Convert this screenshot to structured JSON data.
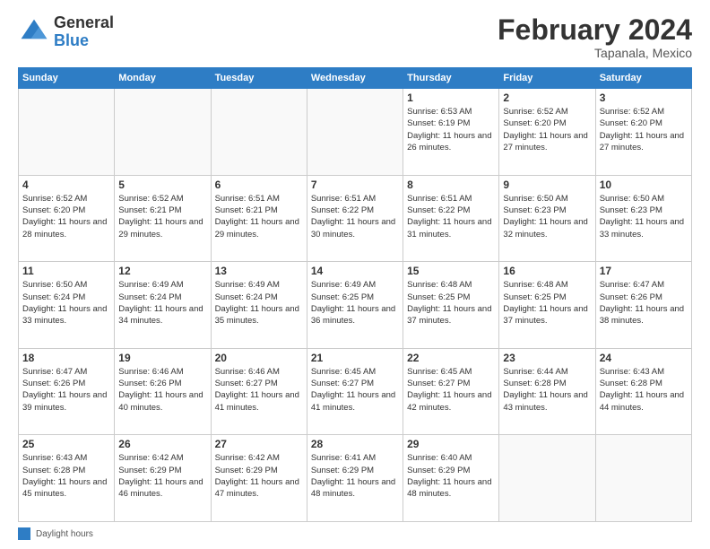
{
  "logo": {
    "general": "General",
    "blue": "Blue"
  },
  "title": "February 2024",
  "subtitle": "Tapanala, Mexico",
  "days_of_week": [
    "Sunday",
    "Monday",
    "Tuesday",
    "Wednesday",
    "Thursday",
    "Friday",
    "Saturday"
  ],
  "weeks": [
    [
      {
        "day": "",
        "info": ""
      },
      {
        "day": "",
        "info": ""
      },
      {
        "day": "",
        "info": ""
      },
      {
        "day": "",
        "info": ""
      },
      {
        "day": "1",
        "info": "Sunrise: 6:53 AM\nSunset: 6:19 PM\nDaylight: 11 hours and 26 minutes."
      },
      {
        "day": "2",
        "info": "Sunrise: 6:52 AM\nSunset: 6:20 PM\nDaylight: 11 hours and 27 minutes."
      },
      {
        "day": "3",
        "info": "Sunrise: 6:52 AM\nSunset: 6:20 PM\nDaylight: 11 hours and 27 minutes."
      }
    ],
    [
      {
        "day": "4",
        "info": "Sunrise: 6:52 AM\nSunset: 6:20 PM\nDaylight: 11 hours and 28 minutes."
      },
      {
        "day": "5",
        "info": "Sunrise: 6:52 AM\nSunset: 6:21 PM\nDaylight: 11 hours and 29 minutes."
      },
      {
        "day": "6",
        "info": "Sunrise: 6:51 AM\nSunset: 6:21 PM\nDaylight: 11 hours and 29 minutes."
      },
      {
        "day": "7",
        "info": "Sunrise: 6:51 AM\nSunset: 6:22 PM\nDaylight: 11 hours and 30 minutes."
      },
      {
        "day": "8",
        "info": "Sunrise: 6:51 AM\nSunset: 6:22 PM\nDaylight: 11 hours and 31 minutes."
      },
      {
        "day": "9",
        "info": "Sunrise: 6:50 AM\nSunset: 6:23 PM\nDaylight: 11 hours and 32 minutes."
      },
      {
        "day": "10",
        "info": "Sunrise: 6:50 AM\nSunset: 6:23 PM\nDaylight: 11 hours and 33 minutes."
      }
    ],
    [
      {
        "day": "11",
        "info": "Sunrise: 6:50 AM\nSunset: 6:24 PM\nDaylight: 11 hours and 33 minutes."
      },
      {
        "day": "12",
        "info": "Sunrise: 6:49 AM\nSunset: 6:24 PM\nDaylight: 11 hours and 34 minutes."
      },
      {
        "day": "13",
        "info": "Sunrise: 6:49 AM\nSunset: 6:24 PM\nDaylight: 11 hours and 35 minutes."
      },
      {
        "day": "14",
        "info": "Sunrise: 6:49 AM\nSunset: 6:25 PM\nDaylight: 11 hours and 36 minutes."
      },
      {
        "day": "15",
        "info": "Sunrise: 6:48 AM\nSunset: 6:25 PM\nDaylight: 11 hours and 37 minutes."
      },
      {
        "day": "16",
        "info": "Sunrise: 6:48 AM\nSunset: 6:25 PM\nDaylight: 11 hours and 37 minutes."
      },
      {
        "day": "17",
        "info": "Sunrise: 6:47 AM\nSunset: 6:26 PM\nDaylight: 11 hours and 38 minutes."
      }
    ],
    [
      {
        "day": "18",
        "info": "Sunrise: 6:47 AM\nSunset: 6:26 PM\nDaylight: 11 hours and 39 minutes."
      },
      {
        "day": "19",
        "info": "Sunrise: 6:46 AM\nSunset: 6:26 PM\nDaylight: 11 hours and 40 minutes."
      },
      {
        "day": "20",
        "info": "Sunrise: 6:46 AM\nSunset: 6:27 PM\nDaylight: 11 hours and 41 minutes."
      },
      {
        "day": "21",
        "info": "Sunrise: 6:45 AM\nSunset: 6:27 PM\nDaylight: 11 hours and 41 minutes."
      },
      {
        "day": "22",
        "info": "Sunrise: 6:45 AM\nSunset: 6:27 PM\nDaylight: 11 hours and 42 minutes."
      },
      {
        "day": "23",
        "info": "Sunrise: 6:44 AM\nSunset: 6:28 PM\nDaylight: 11 hours and 43 minutes."
      },
      {
        "day": "24",
        "info": "Sunrise: 6:43 AM\nSunset: 6:28 PM\nDaylight: 11 hours and 44 minutes."
      }
    ],
    [
      {
        "day": "25",
        "info": "Sunrise: 6:43 AM\nSunset: 6:28 PM\nDaylight: 11 hours and 45 minutes."
      },
      {
        "day": "26",
        "info": "Sunrise: 6:42 AM\nSunset: 6:29 PM\nDaylight: 11 hours and 46 minutes."
      },
      {
        "day": "27",
        "info": "Sunrise: 6:42 AM\nSunset: 6:29 PM\nDaylight: 11 hours and 47 minutes."
      },
      {
        "day": "28",
        "info": "Sunrise: 6:41 AM\nSunset: 6:29 PM\nDaylight: 11 hours and 48 minutes."
      },
      {
        "day": "29",
        "info": "Sunrise: 6:40 AM\nSunset: 6:29 PM\nDaylight: 11 hours and 48 minutes."
      },
      {
        "day": "",
        "info": ""
      },
      {
        "day": "",
        "info": ""
      }
    ]
  ],
  "footer": {
    "legend_label": "Daylight hours"
  }
}
